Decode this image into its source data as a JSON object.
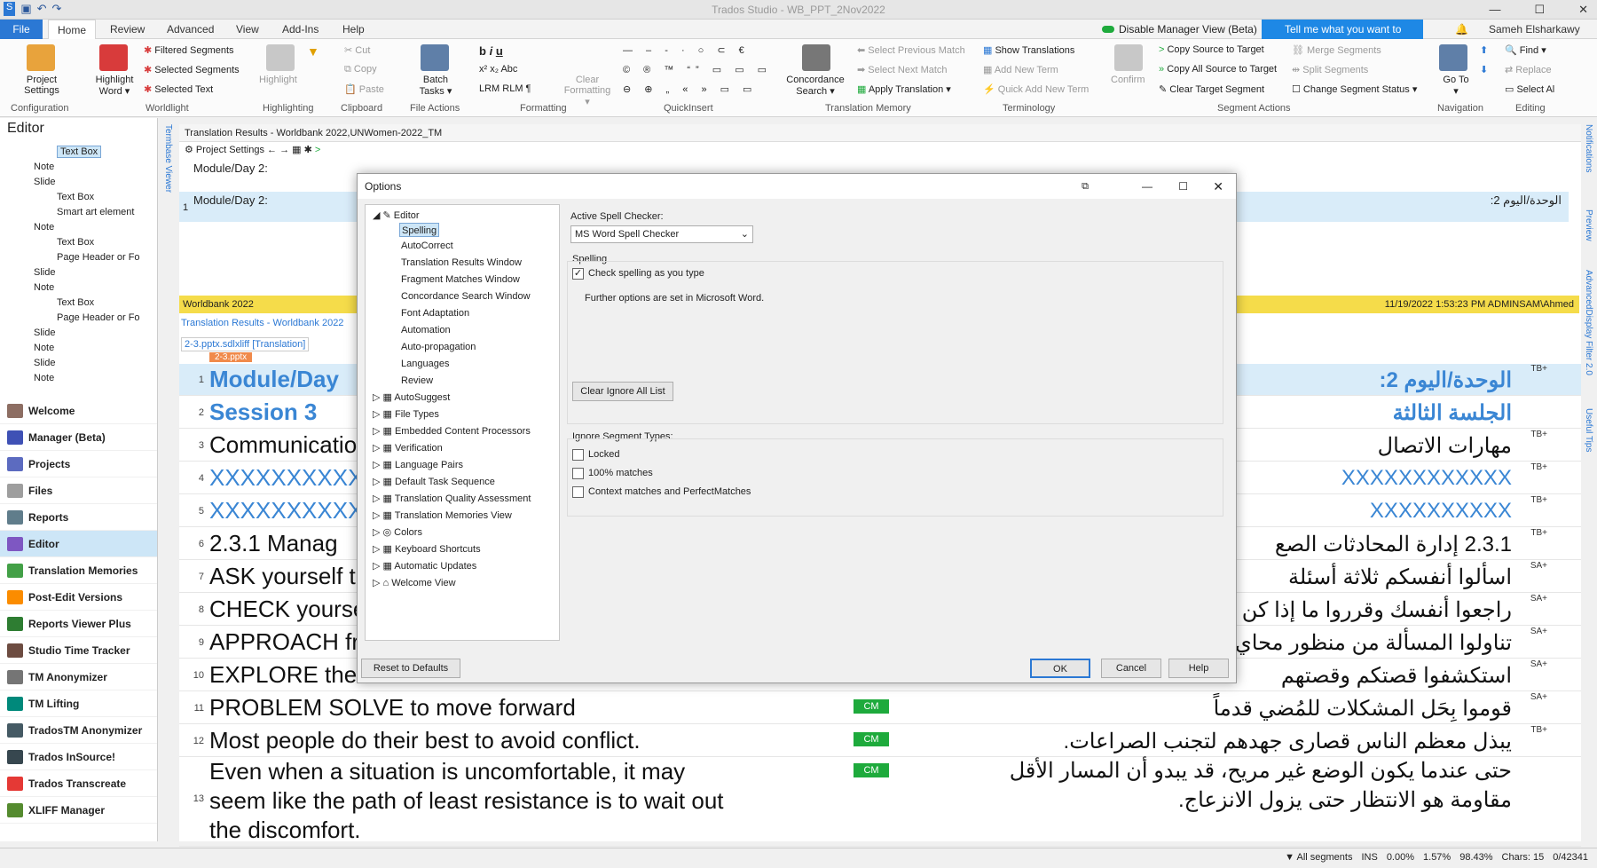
{
  "app": {
    "title": "Trados Studio - WB_PPT_2Nov2022",
    "disable_manager": "Disable Manager View (Beta)",
    "tell_me": "Tell me what you want to do...",
    "user": "Sameh Elsharkawy"
  },
  "tabs": [
    "File",
    "Home",
    "Review",
    "Advanced",
    "View",
    "Add-Ins",
    "Help"
  ],
  "ribbon": {
    "project_settings": "Project Settings",
    "highlight_word": "Highlight Word ▾",
    "filtered_segments": "Filtered Segments",
    "selected_segments": "Selected Segments",
    "selected_text": "Selected Text",
    "highlight": "Highlight",
    "cut": "Cut",
    "copy": "Copy",
    "paste": "Paste",
    "batch_tasks": "Batch Tasks ▾",
    "clear_formatting": "Clear Formatting ▾",
    "concordance_search": "Concordance Search ▾",
    "select_prev": "Select Previous Match",
    "select_next": "Select Next Match",
    "apply_translation": "Apply Translation ▾",
    "show_translations": "Show Translations",
    "add_new_term": "Add New Term",
    "quick_add_term": "Quick Add New Term",
    "confirm": "Confirm",
    "copy_source": "Copy Source to Target",
    "copy_all_source": "Copy All Source to Target",
    "clear_target": "Clear Target Segment",
    "merge_segments": "Merge Segments",
    "split_segments": "Split Segments",
    "change_status": "Change Segment Status ▾",
    "go_to": "Go To ▾",
    "find": "Find ▾",
    "replace": "Replace",
    "select_all": "Select Al",
    "groups": [
      "Configuration",
      "Worldlight",
      "Highlighting",
      "Clipboard",
      "File Actions",
      "Formatting",
      "QuickInsert",
      "Translation Memory",
      "Terminology",
      "Segment Actions",
      "Navigation",
      "Editing"
    ]
  },
  "editor": {
    "title": "Editor",
    "tree": [
      "Text Box",
      "Note",
      "Slide",
      "Text Box",
      "Smart art element",
      "Note",
      "Text Box",
      "Page Header or Fo",
      "Slide",
      "Note",
      "Text Box",
      "Page Header or Fo",
      "Slide",
      "Note",
      "Slide",
      "Note"
    ]
  },
  "nav": [
    "Welcome",
    "Manager (Beta)",
    "Projects",
    "Files",
    "Reports",
    "Editor",
    "Translation Memories",
    "Post-Edit Versions",
    "Reports Viewer Plus",
    "Studio Time Tracker",
    "TM Anonymizer",
    "TM Lifting",
    "TradosTM Anonymizer",
    "Trados InSource!",
    "Trados Transcreate",
    "XLIFF Manager"
  ],
  "results": {
    "header": "Translation Results - Worldbank 2022,UNWomen-2022_TM",
    "project_settings": "Project Settings",
    "src_preview": "Module/Day 2:",
    "row_num": "1",
    "row_src": "Module/Day 2:",
    "row_tgt": "الوحدة/اليوم 2:",
    "bar_left": "Worldbank 2022",
    "bar_right": "11/19/2022 1:53:23 PM  ADMINSAM\\Ahmed",
    "link": "Translation Results - Worldbank 2022",
    "file_tab": "2-3.pptx.sdlxliff [Translation]",
    "file_badge": "2-3.pptx"
  },
  "segments": [
    {
      "n": "1",
      "src": "Module/Day",
      "tgt": "الوحدة/اليوم 2:",
      "st": "TB+"
    },
    {
      "n": "2",
      "src": "Session 3",
      "tgt": "الجلسة الثالثة",
      "st": ""
    },
    {
      "n": "3",
      "src": "Communicatio",
      "tgt": "مهارات الاتصال",
      "st": "TB+"
    },
    {
      "n": "4",
      "src": "XXXXXXXXXXX",
      "tgt": "XXXXXXXXXXXX",
      "st": "TB+"
    },
    {
      "n": "5",
      "src": "XXXXXXXXXX",
      "tgt": "XXXXXXXXXX",
      "st": "TB+"
    },
    {
      "n": "6",
      "src": "2.3.1 Manag",
      "tgt": "2.3.1 إدارة المحادثات الصع",
      "st": "TB+"
    },
    {
      "n": "7",
      "src": "ASK yourself t",
      "tgt": "اسألوا أنفسكم ثلاثة أسئلة",
      "st": "SA+"
    },
    {
      "n": "8",
      "src": "CHECK yourse",
      "tgt": "راجعوا أنفسك وقرروا ما إذا كن",
      "st": "SA+"
    },
    {
      "n": "9",
      "src": "APPROACH fro",
      "tgt": "تناولوا المسألة من منظور محاي",
      "st": "SA+"
    },
    {
      "n": "10",
      "src": "EXPLORE thei",
      "tgt": "استكشفوا قصتكم وقصتهم",
      "st": "SA+"
    },
    {
      "n": "11",
      "src": "PROBLEM SOLVE to move forward",
      "tgt": "قوموا بِحَل المشكلات للمُضي قدماً",
      "st": "SA+"
    },
    {
      "n": "12",
      "src": "Most people do their best to avoid conflict.",
      "tgt": "يبذل معظم الناس قصارى جهدهم لتجنب الصراعات.",
      "st": "TB+"
    },
    {
      "n": "13",
      "src": "Even when a situation is uncomfortable, it may",
      "src2": "seem like the path of least resistance is to wait out",
      "src3": "the discomfort.",
      "tgt": "حتى عندما يكون الوضع غير مريح، قد يبدو أن المسار الأقل",
      "tgt2": "مقاومة هو الانتظار حتى يزول الانزعاج.",
      "st": ""
    }
  ],
  "cm_label": "CM",
  "dialog": {
    "title": "Options",
    "tree": [
      "Editor",
      "Spelling",
      "AutoCorrect",
      "Translation Results Window",
      "Fragment Matches Window",
      "Concordance Search Window",
      "Font Adaptation",
      "Automation",
      "Auto-propagation",
      "Languages",
      "Review",
      "AutoSuggest",
      "File Types",
      "Embedded Content Processors",
      "Verification",
      "Language Pairs",
      "Default Task Sequence",
      "Translation Quality Assessment",
      "Translation Memories View",
      "Colors",
      "Keyboard Shortcuts",
      "Automatic Updates",
      "Welcome View"
    ],
    "active_label": "Active Spell Checker:",
    "active_value": "MS Word Spell Checker",
    "spelling_group": "Spelling",
    "check_spelling": "Check spelling as you type",
    "further": "Further options are set in Microsoft Word.",
    "clear_ignore": "Clear Ignore All List",
    "ignore_group": "Ignore Segment Types:",
    "locked": "Locked",
    "matches100": "100% matches",
    "context": "Context matches and PerfectMatches",
    "reset": "Reset to Defaults",
    "ok": "OK",
    "cancel": "Cancel",
    "help": "Help"
  },
  "side_tabs": [
    "Termbase Viewer",
    "Notifications",
    "Preview",
    "AdvancedDisplay Filter 2.0",
    "Useful Tips"
  ],
  "status": {
    "filter": "All segments",
    "ins": "INS",
    "p1": "0.00%",
    "p2": "1.57%",
    "p3": "98.43%",
    "chars": "Chars: 15",
    "count": "0/42341"
  }
}
